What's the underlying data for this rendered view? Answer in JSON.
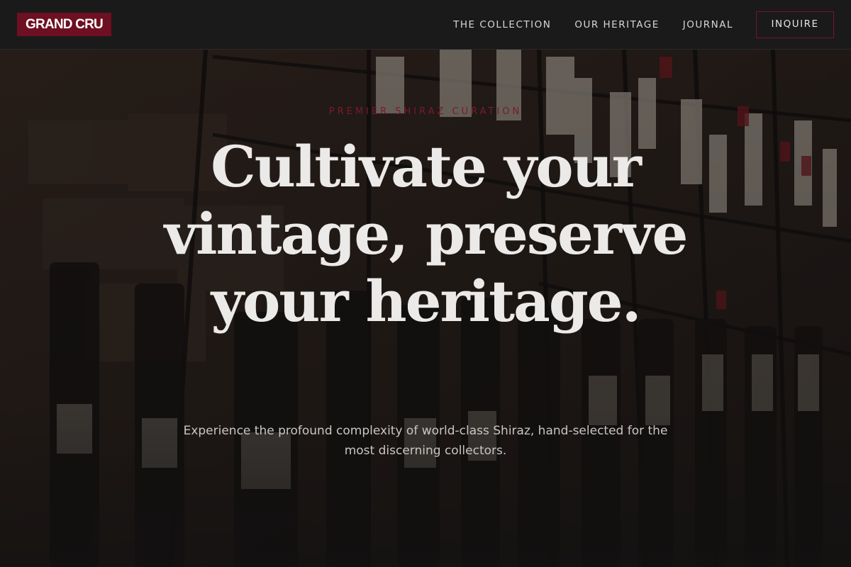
{
  "header": {
    "logo": "GRAND CRU",
    "nav": [
      {
        "label": "THE COLLECTION"
      },
      {
        "label": "OUR HERITAGE"
      },
      {
        "label": "JOURNAL"
      }
    ],
    "cta_label": "INQUIRE"
  },
  "hero": {
    "eyebrow": "PREMIER SHIRAZ CURATION",
    "headline": "Cultivate your vintage, preserve your heritage.",
    "subtext": "Experience the profound complexity of world-class Shiraz, hand-selected for the most discerning collectors."
  },
  "colors": {
    "accent": "#6e0f22",
    "header_bg": "#1a1a1b",
    "headline": "#eceae8",
    "eyebrow": "#7a1a2c"
  }
}
